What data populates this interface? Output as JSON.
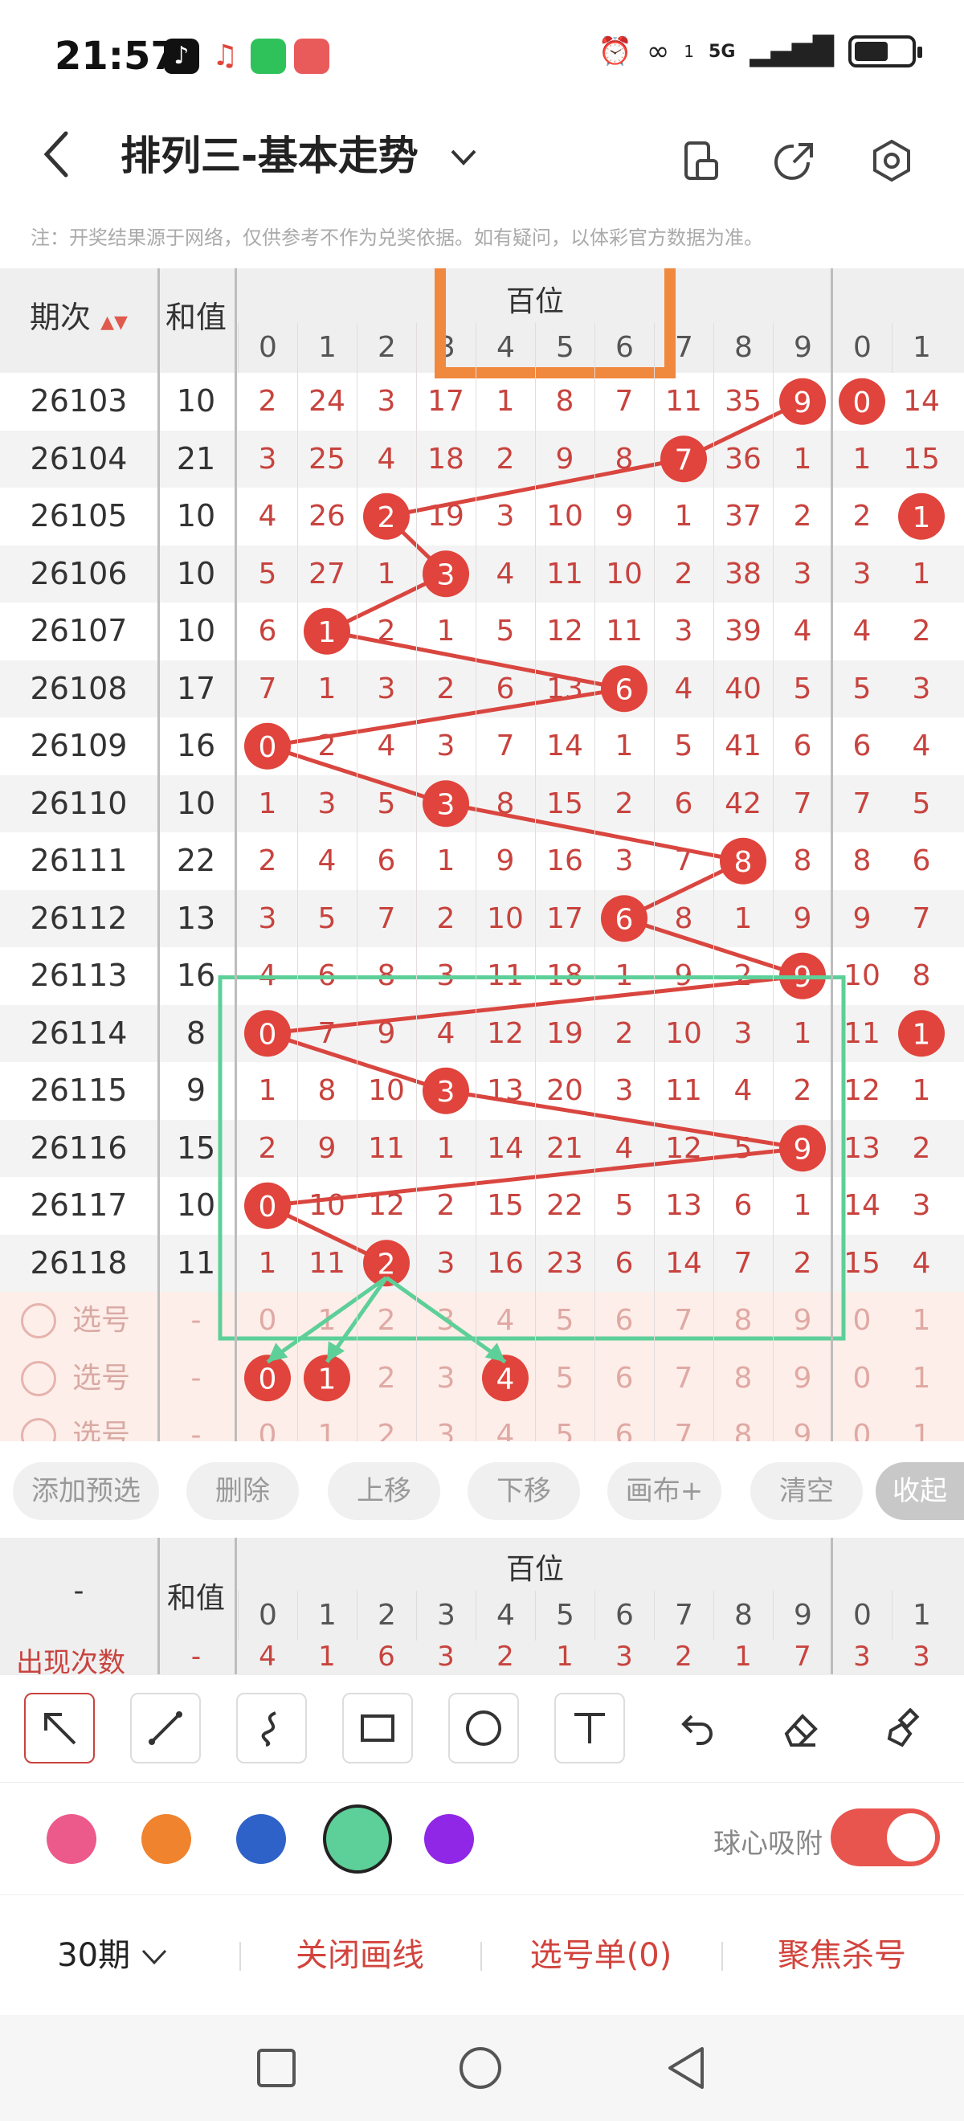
{
  "status": {
    "time": "21:57",
    "network": "5G",
    "sim": "1"
  },
  "header": {
    "title": "排列三-基本走势",
    "notice": "注：开奖结果源于网络，仅供参考不作为兑奖依据。如有疑问，以体彩官方数据为准。"
  },
  "table": {
    "col_period": "期次",
    "col_sum": "和值",
    "section_hundreds": "百位",
    "digits": [
      "0",
      "1",
      "2",
      "3",
      "4",
      "5",
      "6",
      "7",
      "8",
      "9"
    ],
    "tens_digits_visible": [
      "0",
      "1"
    ],
    "rows": [
      {
        "period": "26103",
        "sum": "10",
        "cells": [
          "2",
          "24",
          "3",
          "17",
          "1",
          "8",
          "7",
          "11",
          "35",
          "9"
        ],
        "hit": 9,
        "tens": [
          "0",
          "14"
        ],
        "tens_hit": 0
      },
      {
        "period": "26104",
        "sum": "21",
        "cells": [
          "3",
          "25",
          "4",
          "18",
          "2",
          "9",
          "8",
          "7",
          "36",
          "1"
        ],
        "hit": 7,
        "tens": [
          "1",
          "15"
        ],
        "tens_hit": -1
      },
      {
        "period": "26105",
        "sum": "10",
        "cells": [
          "4",
          "26",
          "2",
          "19",
          "3",
          "10",
          "9",
          "1",
          "37",
          "2"
        ],
        "hit": 2,
        "tens": [
          "2",
          "1"
        ],
        "tens_hit": 1
      },
      {
        "period": "26106",
        "sum": "10",
        "cells": [
          "5",
          "27",
          "1",
          "3",
          "4",
          "11",
          "10",
          "2",
          "38",
          "3"
        ],
        "hit": 3,
        "tens": [
          "3",
          "1"
        ],
        "tens_hit": -1
      },
      {
        "period": "26107",
        "sum": "10",
        "cells": [
          "6",
          "1",
          "2",
          "1",
          "5",
          "12",
          "11",
          "3",
          "39",
          "4"
        ],
        "hit": 1,
        "tens": [
          "4",
          "2"
        ],
        "tens_hit": -1
      },
      {
        "period": "26108",
        "sum": "17",
        "cells": [
          "7",
          "1",
          "3",
          "2",
          "6",
          "13",
          "6",
          "4",
          "40",
          "5"
        ],
        "hit": 6,
        "tens": [
          "5",
          "3"
        ],
        "tens_hit": -1
      },
      {
        "period": "26109",
        "sum": "16",
        "cells": [
          "0",
          "2",
          "4",
          "3",
          "7",
          "14",
          "1",
          "5",
          "41",
          "6"
        ],
        "hit": 0,
        "tens": [
          "6",
          "4"
        ],
        "tens_hit": -1
      },
      {
        "period": "26110",
        "sum": "10",
        "cells": [
          "1",
          "3",
          "5",
          "3",
          "8",
          "15",
          "2",
          "6",
          "42",
          "7"
        ],
        "hit": 3,
        "tens": [
          "7",
          "5"
        ],
        "tens_hit": -1
      },
      {
        "period": "26111",
        "sum": "22",
        "cells": [
          "2",
          "4",
          "6",
          "1",
          "9",
          "16",
          "3",
          "7",
          "8",
          "8"
        ],
        "hit": 8,
        "tens": [
          "8",
          "6"
        ],
        "tens_hit": -1
      },
      {
        "period": "26112",
        "sum": "13",
        "cells": [
          "3",
          "5",
          "7",
          "2",
          "10",
          "17",
          "6",
          "8",
          "1",
          "9"
        ],
        "hit": 6,
        "tens": [
          "9",
          "7"
        ],
        "tens_hit": -1
      },
      {
        "period": "26113",
        "sum": "16",
        "cells": [
          "4",
          "6",
          "8",
          "3",
          "11",
          "18",
          "1",
          "9",
          "2",
          "9"
        ],
        "hit": 9,
        "tens": [
          "10",
          "8"
        ],
        "tens_hit": -1
      },
      {
        "period": "26114",
        "sum": "8",
        "cells": [
          "0",
          "7",
          "9",
          "4",
          "12",
          "19",
          "2",
          "10",
          "3",
          "1"
        ],
        "hit": 0,
        "tens": [
          "11",
          "1"
        ],
        "tens_hit": 1
      },
      {
        "period": "26115",
        "sum": "9",
        "cells": [
          "1",
          "8",
          "10",
          "3",
          "13",
          "20",
          "3",
          "11",
          "4",
          "2"
        ],
        "hit": 3,
        "tens": [
          "12",
          "1"
        ],
        "tens_hit": -1
      },
      {
        "period": "26116",
        "sum": "15",
        "cells": [
          "2",
          "9",
          "11",
          "1",
          "14",
          "21",
          "4",
          "12",
          "5",
          "9"
        ],
        "hit": 9,
        "tens": [
          "13",
          "2"
        ],
        "tens_hit": -1
      },
      {
        "period": "26117",
        "sum": "10",
        "cells": [
          "0",
          "10",
          "12",
          "2",
          "15",
          "22",
          "5",
          "13",
          "6",
          "1"
        ],
        "hit": 0,
        "tens": [
          "14",
          "3"
        ],
        "tens_hit": -1
      },
      {
        "period": "26118",
        "sum": "11",
        "cells": [
          "1",
          "11",
          "2",
          "3",
          "16",
          "23",
          "6",
          "14",
          "7",
          "2"
        ],
        "hit": 2,
        "tens": [
          "15",
          "4"
        ],
        "tens_hit": -1
      }
    ],
    "pick_rows": [
      {
        "label": "选号",
        "sum": "-",
        "selected": []
      },
      {
        "label": "选号",
        "sum": "-",
        "selected": [
          0,
          1,
          4
        ]
      },
      {
        "label": "选号",
        "sum": "-",
        "selected": []
      }
    ]
  },
  "actions": {
    "add": "添加预选",
    "delete": "删除",
    "up": "上移",
    "down": "下移",
    "canvas": "画布+",
    "clear": "清空",
    "collapse": "收起"
  },
  "stats": {
    "col_first": "-",
    "col_sum": "和值",
    "section_hundreds": "百位",
    "label": "出现次数",
    "sum_value": "-",
    "values": [
      "4",
      "1",
      "6",
      "3",
      "2",
      "1",
      "3",
      "2",
      "1",
      "7"
    ],
    "tens_values": [
      "3",
      "3"
    ]
  },
  "draw": {
    "snap_label": "球心吸附",
    "colors": [
      "#ec5a8c",
      "#f0832e",
      "#2f62c9",
      "#5dcf98",
      "#9027e6"
    ],
    "selected_color": "#5dcf98",
    "snap_on": true,
    "tools": [
      "arrow-tool-icon",
      "line-tool-icon",
      "curve-tool-icon",
      "rect-tool-icon",
      "circle-tool-icon",
      "text-tool-icon",
      "undo-icon",
      "eraser-icon",
      "brush-clear-icon"
    ]
  },
  "bottom": {
    "periods": "30期",
    "close_draw": "关闭画线",
    "pick_list": "选号单(0)",
    "focus_kill": "聚焦杀号"
  }
}
